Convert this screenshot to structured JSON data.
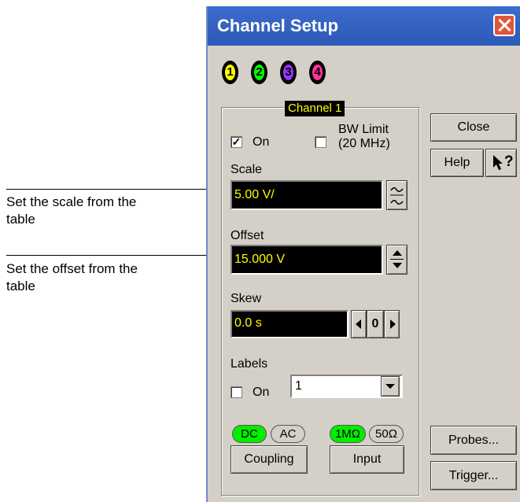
{
  "annotations": {
    "scale_line1": "Set the scale from the",
    "scale_line2": "table",
    "offset_line1": "Set the offset from the",
    "offset_line2": "table"
  },
  "dialog": {
    "title": "Channel Setup",
    "channels": [
      "1",
      "2",
      "3",
      "4"
    ],
    "channel_colors": [
      "#ffff00",
      "#00ff00",
      "#9933ff",
      "#ff3399"
    ],
    "group_label": "Channel 1",
    "on_label": "On",
    "on_checked": "✓",
    "bw_limit_line1": "BW Limit",
    "bw_limit_line2": "(20 MHz)",
    "scale_label": "Scale",
    "scale_value": "5.00 V/",
    "offset_label": "Offset",
    "offset_value": "15.000 V",
    "skew_label": "Skew",
    "skew_value": "0.0 s",
    "skew_zero": "0",
    "labels_label": "Labels",
    "labels_on_label": "On",
    "labels_value": "1",
    "coupling": {
      "dc": "DC",
      "ac": "AC",
      "button": "Coupling"
    },
    "input": {
      "one_meg": "1MΩ",
      "fifty": "50Ω",
      "button": "Input"
    },
    "buttons": {
      "close": "Close",
      "help": "Help",
      "whatsthis": "?",
      "probes": "Probes...",
      "trigger": "Trigger..."
    },
    "active_color": "#00ee00"
  }
}
